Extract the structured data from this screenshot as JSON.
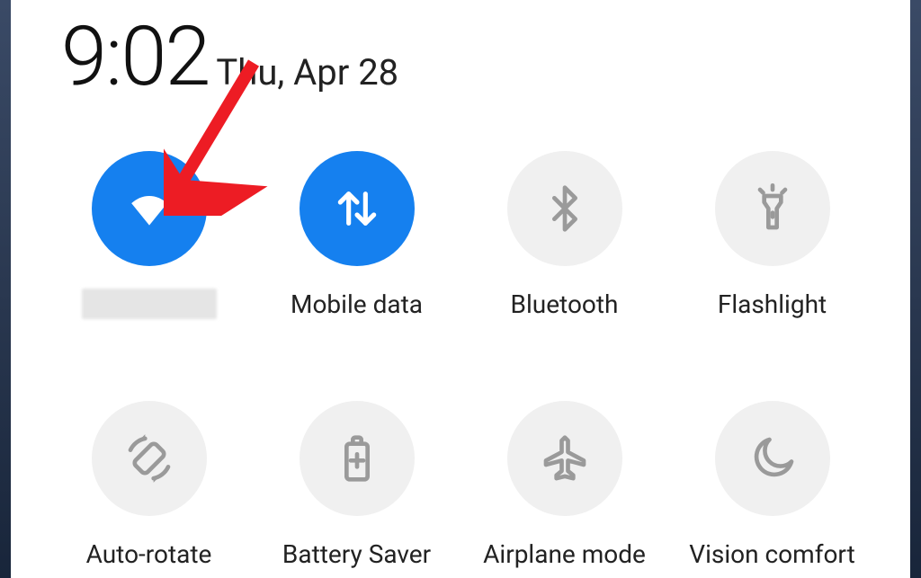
{
  "header": {
    "time": "9:02",
    "date": "Thu, Apr 28"
  },
  "tiles": [
    {
      "id": "wifi",
      "label": "",
      "active": true,
      "icon": "wifi-icon",
      "redacted_label": true
    },
    {
      "id": "mobile-data",
      "label": "Mobile data",
      "active": true,
      "icon": "mobile-data-icon",
      "redacted_label": false
    },
    {
      "id": "bluetooth",
      "label": "Bluetooth",
      "active": false,
      "icon": "bluetooth-icon",
      "redacted_label": false
    },
    {
      "id": "flashlight",
      "label": "Flashlight",
      "active": false,
      "icon": "flashlight-icon",
      "redacted_label": false
    },
    {
      "id": "auto-rotate",
      "label": "Auto-rotate",
      "active": false,
      "icon": "auto-rotate-icon",
      "redacted_label": false
    },
    {
      "id": "battery-saver",
      "label": "Battery Saver",
      "active": false,
      "icon": "battery-saver-icon",
      "redacted_label": false
    },
    {
      "id": "airplane-mode",
      "label": "Airplane mode",
      "active": false,
      "icon": "airplane-icon",
      "redacted_label": false
    },
    {
      "id": "vision-comfort",
      "label": "Vision comfort",
      "active": false,
      "icon": "moon-icon",
      "redacted_label": false
    }
  ],
  "colors": {
    "accent": "#1580ef",
    "inactive_bg": "#f0f0f0",
    "inactive_fg": "#9a9a9a",
    "arrow": "#ed1c24"
  },
  "annotation": {
    "type": "arrow",
    "target_tile": "wifi"
  }
}
